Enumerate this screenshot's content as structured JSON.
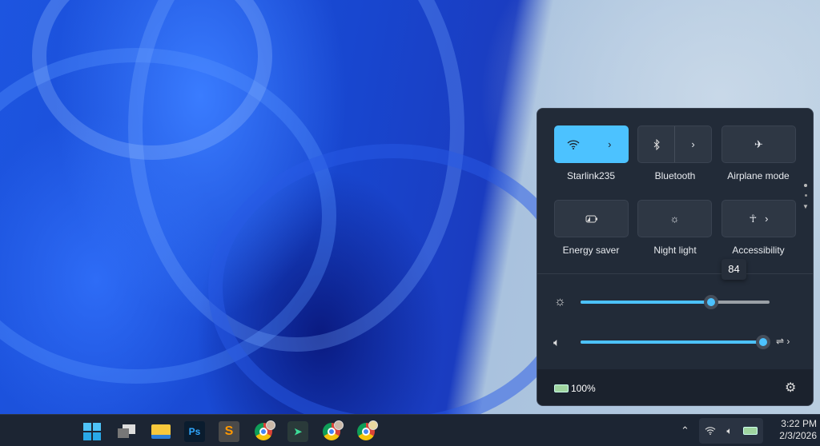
{
  "quick_settings": {
    "tiles": [
      {
        "label": "Starlink235",
        "icon": "wifi-icon",
        "active": true,
        "has_arrow": true
      },
      {
        "label": "Bluetooth",
        "icon": "bluetooth-icon",
        "active": false,
        "has_arrow": true
      },
      {
        "label": "Airplane mode",
        "icon": "airplane-icon",
        "active": false
      },
      {
        "label": "Energy saver",
        "icon": "energy-saver-icon",
        "active": false
      },
      {
        "label": "Night light",
        "icon": "night-light-icon",
        "active": false
      },
      {
        "label": "Accessibility",
        "icon": "accessibility-icon",
        "active": false,
        "has_arrow": true
      }
    ],
    "brightness": {
      "value": 84,
      "tooltip": "84"
    },
    "volume": {
      "value": 100
    },
    "battery": "100%",
    "accent": "#4cc2ff"
  },
  "taskbar": {
    "apps": [
      "start",
      "task-view",
      "file-explorer",
      "photoshop",
      "sublime-text",
      "chrome-profile-1",
      "app-launcher",
      "chrome-profile-2",
      "chrome-profile-3"
    ],
    "ps_label": "Ps",
    "clock": {
      "time": "3:22 PM",
      "date": "2/3/2026"
    }
  }
}
